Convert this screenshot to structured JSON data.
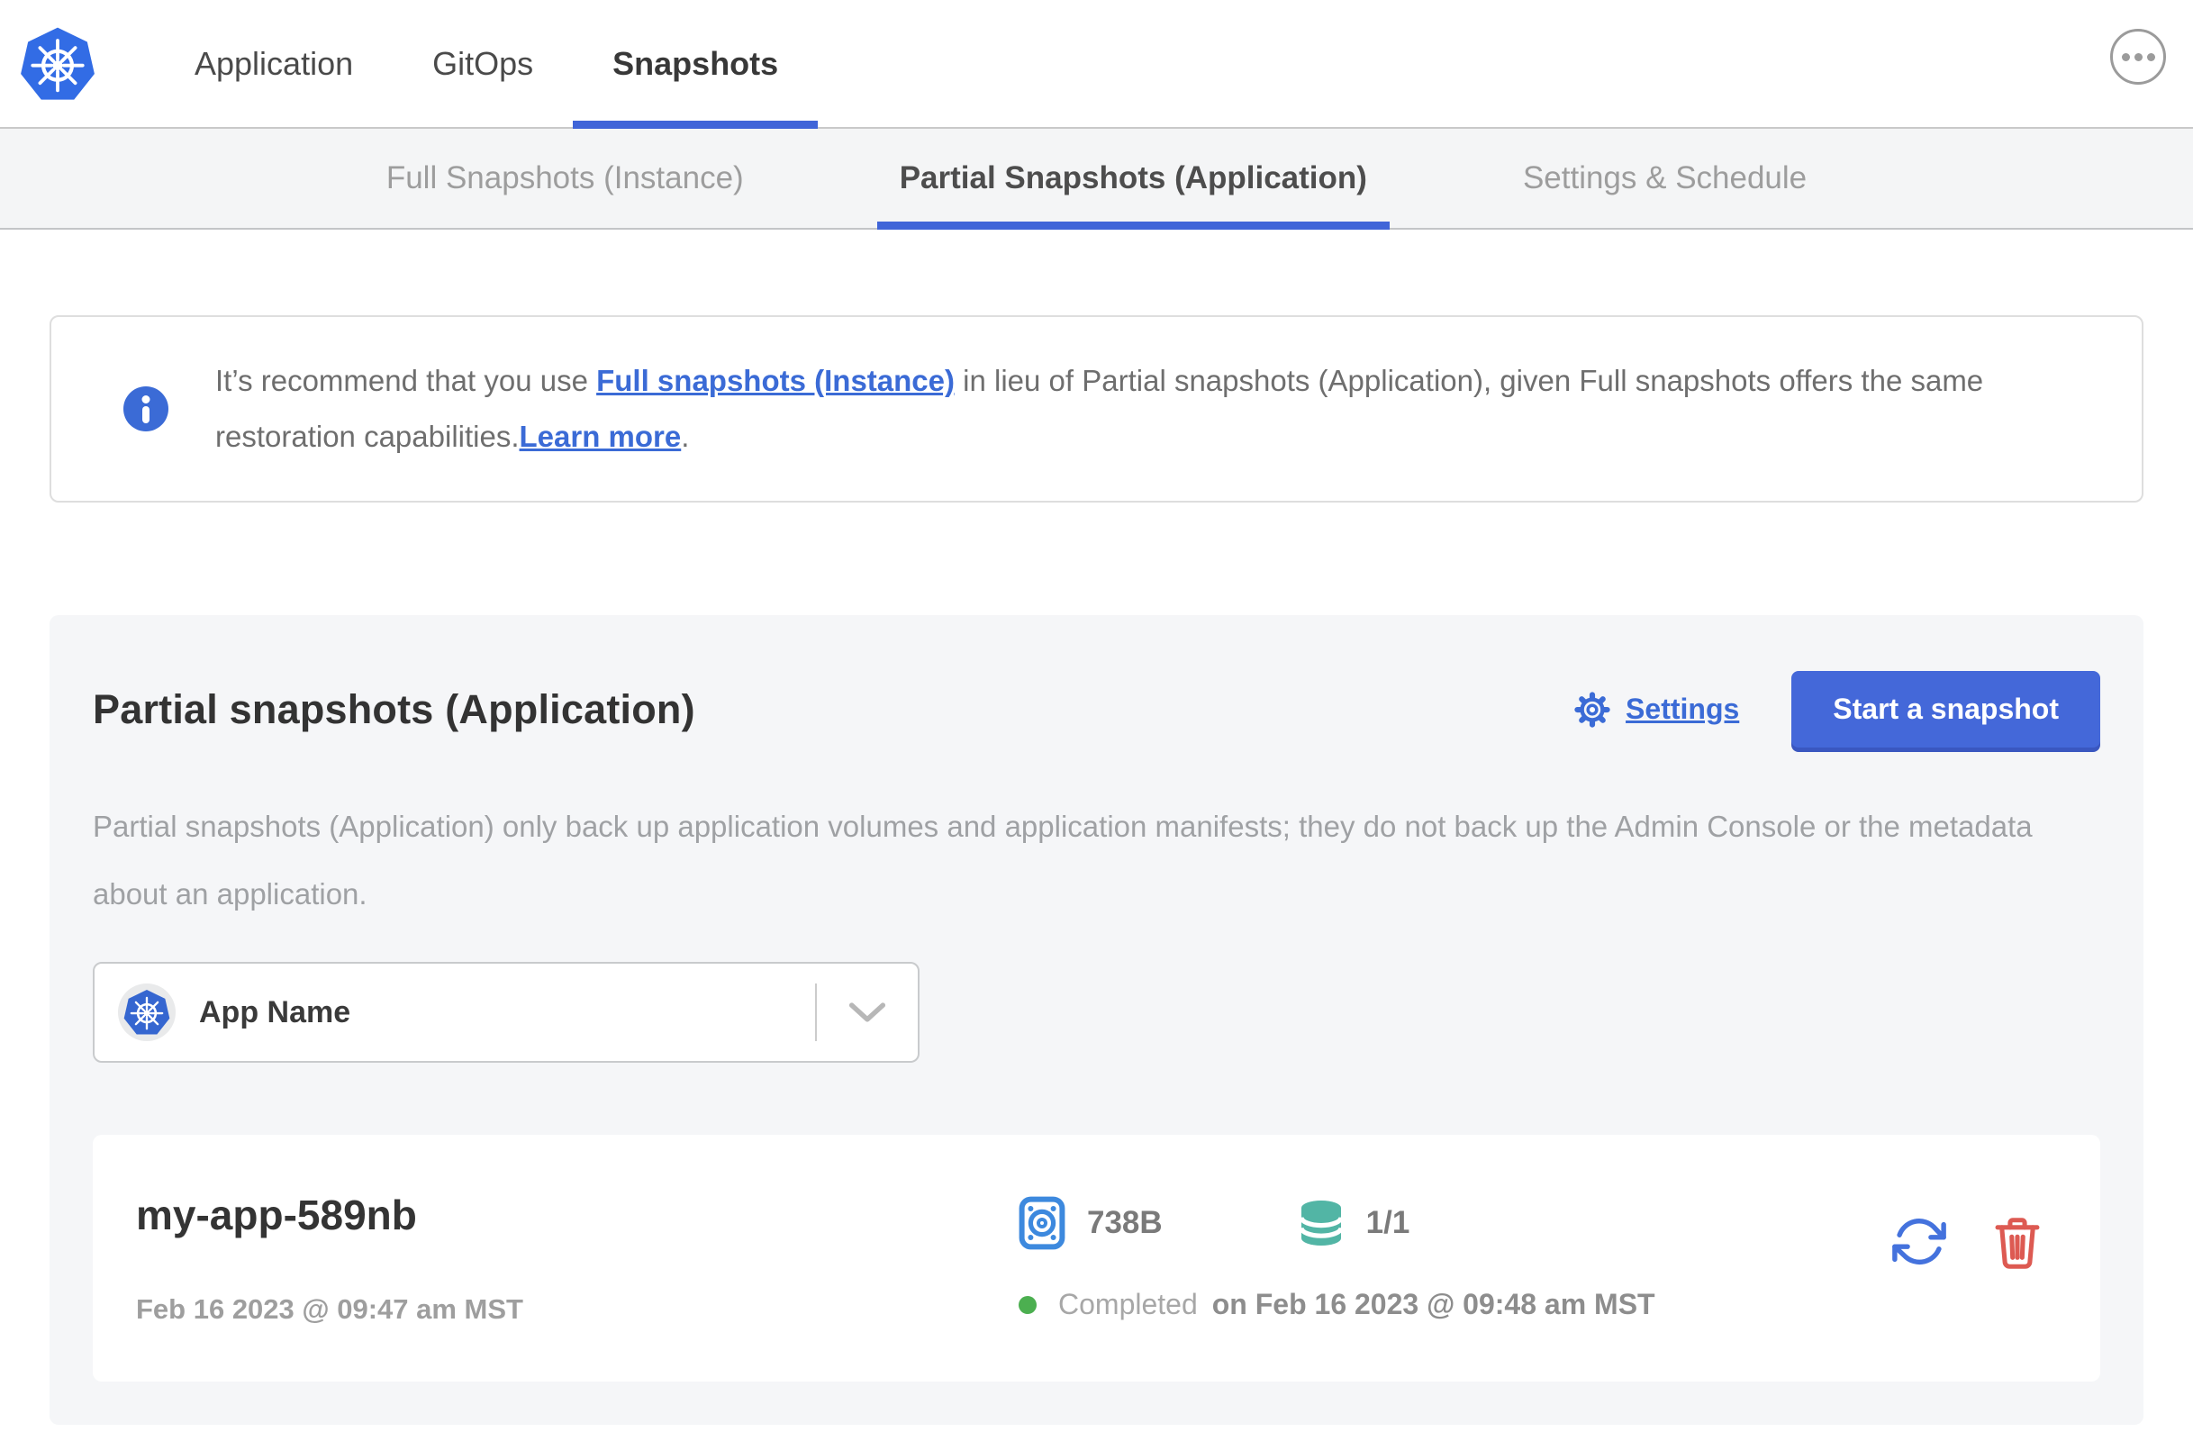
{
  "header": {
    "nav": [
      {
        "label": "Application"
      },
      {
        "label": "GitOps"
      },
      {
        "label": "Snapshots"
      }
    ]
  },
  "subtabs": [
    {
      "label": "Full Snapshots (Instance)"
    },
    {
      "label": "Partial Snapshots (Application)"
    },
    {
      "label": "Settings & Schedule"
    }
  ],
  "banner": {
    "text_before": "It’s recommend that you use ",
    "instance_link": "Full snapshots (Instance)",
    "text_middle": " in lieu of Partial snapshots (Application), given Full snapshots offers the same restoration capabilities.",
    "learn_more_link": "Learn more",
    "text_after": "."
  },
  "panel": {
    "title": "Partial snapshots (Application)",
    "settings_label": "Settings",
    "start_snapshot_label": "Start a snapshot",
    "description": "Partial snapshots (Application) only back up application volumes and application manifests; they do not back up the Admin Console or the metadata about an application.",
    "app_selector": {
      "selected": "App Name"
    }
  },
  "snapshot_row": {
    "name": "my-app-589nb",
    "started_at": "Feb 16 2023 @ 09:47 am MST",
    "size": "738B",
    "volumes": "1/1",
    "status": "Completed",
    "finished_at": "on Feb 16 2023 @ 09:48 am MST"
  },
  "colors": {
    "accent_blue": "#3b6bd6",
    "active_tab_underline": "#4065d8",
    "kubernetes_blue": "#326ce5",
    "disk_icon_blue": "#3d89de",
    "volume_icon_teal": "#52b5a5",
    "status_green": "#4caf50",
    "delete_red": "#dd5a52",
    "panel_background": "#f5f6f8"
  }
}
